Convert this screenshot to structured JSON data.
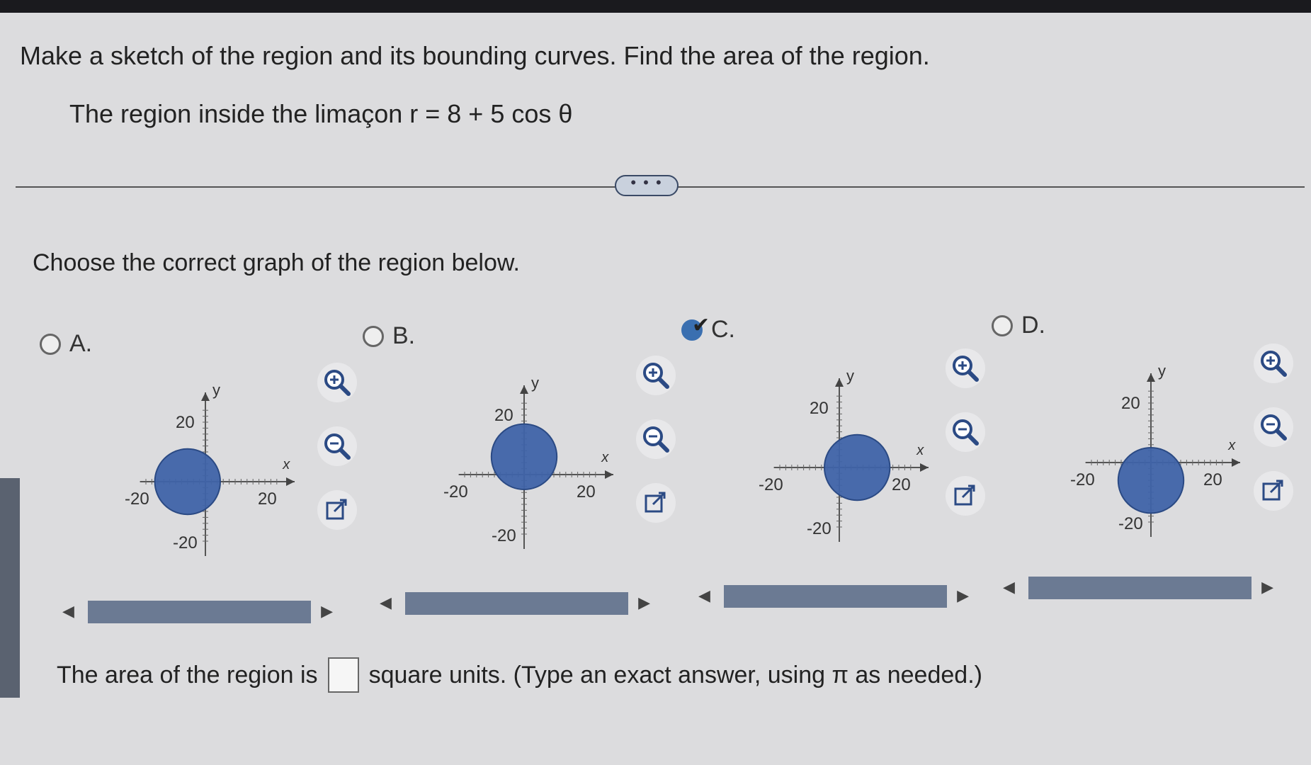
{
  "question": "Make a sketch of the region and its bounding curves. Find the area of the region.",
  "region": "The region inside the limaçon r = 8 + 5 cos θ",
  "more_button": "• • •",
  "prompt": "Choose the correct graph of the region below.",
  "options": [
    {
      "label": "A.",
      "selected": false,
      "x_label": "x",
      "y_label": "y",
      "ticks": {
        "pos": "20",
        "neg": "-20"
      }
    },
    {
      "label": "B.",
      "selected": false,
      "x_label": "x",
      "y_label": "y",
      "ticks": {
        "pos": "20",
        "neg": "-20"
      }
    },
    {
      "label": "C.",
      "selected": true,
      "x_label": "x",
      "y_label": "y",
      "ticks": {
        "pos": "20",
        "neg": "-20"
      }
    },
    {
      "label": "D.",
      "selected": false,
      "x_label": "x",
      "y_label": "y",
      "ticks": {
        "pos": "20",
        "neg": "-20"
      }
    }
  ],
  "tools": {
    "zoom_in": "zoom-in-icon",
    "zoom_out": "zoom-out-icon",
    "popout": "popout-icon"
  },
  "answer": {
    "prefix": "The area of the region is",
    "suffix": "square units. (Type an exact answer, using π as needed.)",
    "value": ""
  },
  "colors": {
    "fill": "#3f63a8",
    "accent": "#3a6fb0"
  }
}
